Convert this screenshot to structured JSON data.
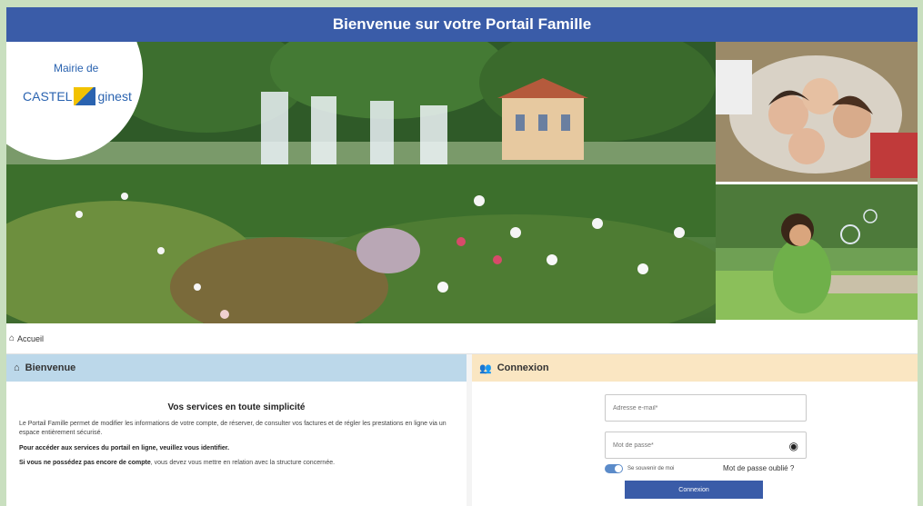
{
  "header": {
    "title": "Bienvenue sur votre Portail Famille"
  },
  "logo": {
    "line1": "Mairie de",
    "line2a": "CASTEL",
    "line2b": "ginest"
  },
  "breadcrumb": {
    "home_icon": "home-icon",
    "label": "Accueil"
  },
  "welcome": {
    "heading": "Bienvenue",
    "icon": "home-icon",
    "title": "Vos services en toute simplicité",
    "intro": "Le Portail Famille permet de modifier les informations de votre compte, de réserver, de consulter vos factures et de régler les prestations en ligne via un espace entièrement sécurisé.",
    "identify": "Pour accéder aux services du portail en ligne, veuillez vous identifier.",
    "no_account_bold": "Si vous ne possédez pas encore de compte",
    "no_account_rest": ", vous devez vous mettre en relation avec la structure concernée."
  },
  "login": {
    "heading": "Connexion",
    "icon": "users-icon",
    "email_placeholder": "Adresse e-mail*",
    "password_placeholder": "Mot de passe*",
    "remember_label": "Se souvenir de moi",
    "forgot_label": "Mot de passe oublié ?",
    "submit_label": "Connexion"
  },
  "colors": {
    "header_blue": "#3a5ca8",
    "welcome_head": "#bcd8ea",
    "login_head": "#fae6c2",
    "page_bg": "#c9dfbf"
  }
}
